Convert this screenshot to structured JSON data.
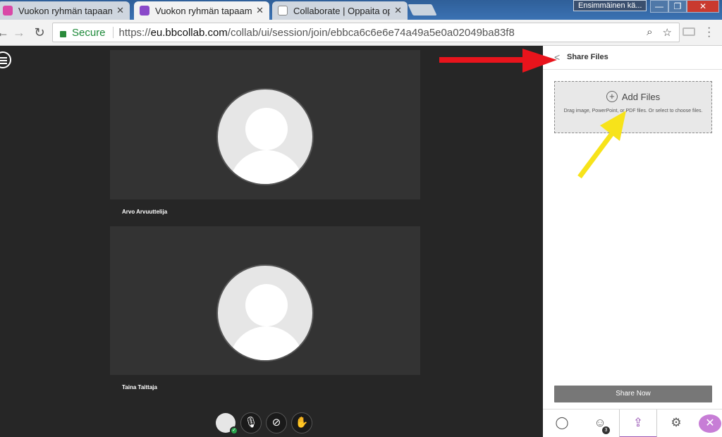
{
  "browser": {
    "tabs": [
      {
        "title": "Vuokon ryhmän tapaami",
        "favicon_color": "#d948a7",
        "close": "✕"
      },
      {
        "title": "Vuokon ryhmän tapaami",
        "favicon_color": "#8a49c9",
        "close": "✕"
      },
      {
        "title": "Collaborate | Oppaita op",
        "favicon_color": "#ffffff",
        "close": "✕"
      }
    ],
    "profile_name": "Ensimmäinen kä...",
    "window_controls": {
      "minimize": "—",
      "maximize": "❐",
      "close": "✕"
    },
    "secure_label": "Secure",
    "url_scheme": "https://",
    "url_host": "eu.bbcollab.com",
    "url_path": "/collab/ui/session/join/ebbca6c6e6e74a49a5e0a02049ba83f8",
    "icons": [
      "back-icon",
      "forward-icon",
      "reload-icon",
      "lock-icon",
      "zoom-icon",
      "star-icon",
      "cast-icon",
      "menu-icon"
    ]
  },
  "stage": {
    "participants": [
      {
        "name": "Arvo Arvuuttelija"
      },
      {
        "name": "Taina Taittaja"
      }
    ],
    "controls": {
      "mic_icon": "microphone-off-icon",
      "camera_icon": "camera-off-icon",
      "hand_icon": "raise-hand-icon",
      "status_icon": "check-icon"
    }
  },
  "panel": {
    "title": "Share Files",
    "add_files_label": "Add Files",
    "drop_help": "Drag image, PowerPoint, or PDF files. Or select to choose files.",
    "share_now_label": "Share Now",
    "tabs": [
      {
        "icon": "chat-icon"
      },
      {
        "icon": "participants-icon",
        "badge": "3"
      },
      {
        "icon": "share-content-icon",
        "active": true
      },
      {
        "icon": "settings-icon"
      }
    ],
    "close_icon": "close-icon"
  },
  "annotations": {
    "red_arrow_color": "#e8141c",
    "yellow_arrow_color": "#f7e31a"
  }
}
